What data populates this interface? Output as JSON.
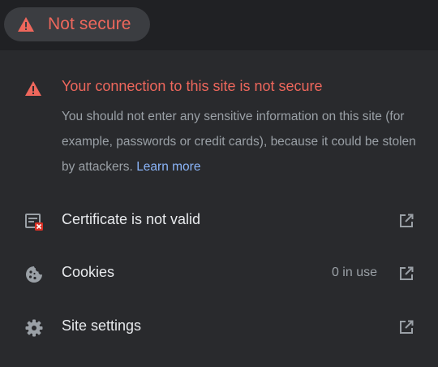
{
  "chip": {
    "label": "Not secure",
    "icon": "warning-triangle-icon",
    "color": "#ee675c"
  },
  "warning": {
    "icon": "warning-triangle-icon",
    "title": "Your connection to this site is not secure",
    "body": "You should not enter any sensitive information on this site (for example, passwords or credit cards), because it could be stolen by attackers.",
    "learn_more": "Learn more"
  },
  "rows": [
    {
      "id": "certificate",
      "icon": "certificate-error-icon",
      "label": "Certificate is not valid",
      "status": "",
      "action_icon": "open-external-icon"
    },
    {
      "id": "cookies",
      "icon": "cookie-icon",
      "label": "Cookies",
      "status": "0 in use",
      "action_icon": "open-external-icon"
    },
    {
      "id": "site-settings",
      "icon": "gear-icon",
      "label": "Site settings",
      "status": "",
      "action_icon": "open-external-icon"
    }
  ],
  "colors": {
    "background": "#202124",
    "panel": "#292a2d",
    "danger": "#ee675c",
    "link": "#8ab4f8",
    "text_primary": "#e8eaed",
    "text_secondary": "#9aa0a6"
  }
}
